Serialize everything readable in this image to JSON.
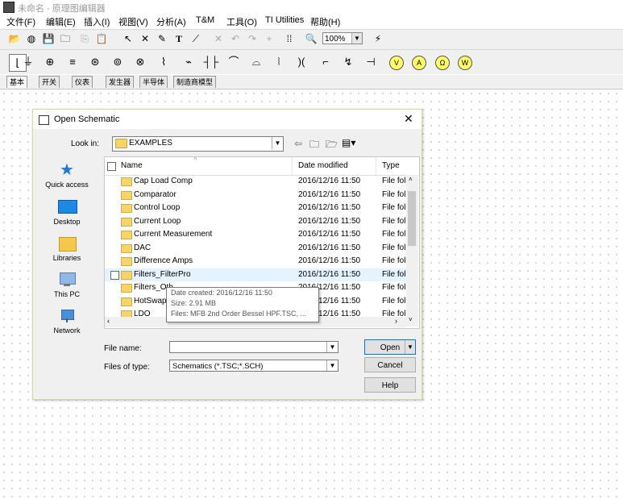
{
  "app": {
    "title": "未命名 - 原理图编辑器"
  },
  "menu": [
    "文件(F)",
    "编辑(E)",
    "插入(I)",
    "视图(V)",
    "分析(A)",
    "T&M",
    "工具(O)",
    "TI Utilities",
    "帮助(H)"
  ],
  "toolbar": {
    "zoom_value": "100%"
  },
  "component_tabs": [
    "基本",
    "开关",
    "仪表",
    "发生器",
    "半导体",
    "制造商模型"
  ],
  "dialog": {
    "title": "Open Schematic",
    "look_in_label": "Look in:",
    "look_in_value": "EXAMPLES",
    "places": [
      "Quick access",
      "Desktop",
      "Libraries",
      "This PC",
      "Network"
    ],
    "columns": {
      "name": "Name",
      "date": "Date modified",
      "type": "Type"
    },
    "rows": [
      {
        "name": "Cap Load Comp",
        "date": "2016/12/16 11:50",
        "type": "File fol"
      },
      {
        "name": "Comparator",
        "date": "2016/12/16 11:50",
        "type": "File fol"
      },
      {
        "name": "Control Loop",
        "date": "2016/12/16 11:50",
        "type": "File fol"
      },
      {
        "name": "Current Loop",
        "date": "2016/12/16 11:50",
        "type": "File fol"
      },
      {
        "name": "Current Measurement",
        "date": "2016/12/16 11:50",
        "type": "File fol"
      },
      {
        "name": "DAC",
        "date": "2016/12/16 11:50",
        "type": "File fol"
      },
      {
        "name": "Difference Amps",
        "date": "2016/12/16 11:50",
        "type": "File fol"
      },
      {
        "name": "Filters_FilterPro",
        "date": "2016/12/16 11:50",
        "type": "File fol"
      },
      {
        "name": "Filters_Oth",
        "date": "2016/12/16 11:50",
        "type": "File fol"
      },
      {
        "name": "HotSwap",
        "date": "2016/12/16 11:50",
        "type": "File fol"
      },
      {
        "name": "LDO",
        "date": "2016/12/16 11:50",
        "type": "File fol"
      }
    ],
    "tooltip": {
      "created": "Date created: 2016/12/16 11:50",
      "size": "Size: 2.91 MB",
      "files": "Files: MFB 2nd Order Bessel HPF.TSC, ..."
    },
    "file_name_label": "File name:",
    "file_name_value": "",
    "file_type_label": "Files of type:",
    "file_type_value": "Schematics (*.TSC;*.SCH)",
    "open_label": "Open",
    "cancel_label": "Cancel",
    "help_label": "Help"
  }
}
